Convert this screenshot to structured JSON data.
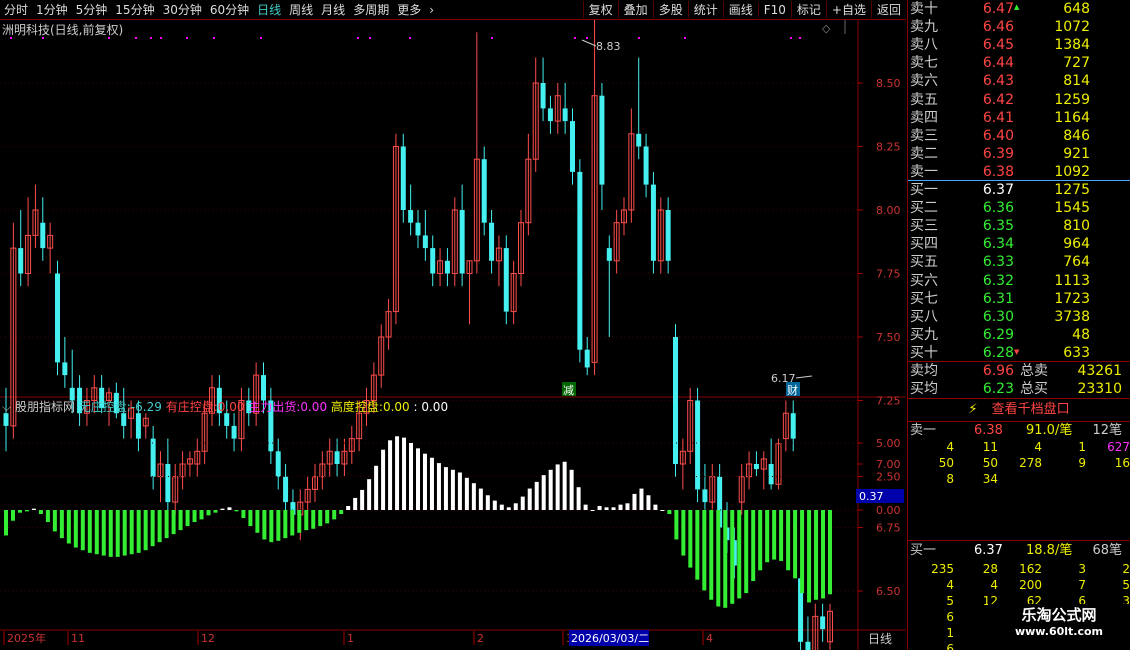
{
  "toolbar": {
    "periods": [
      "分时",
      "1分钟",
      "5分钟",
      "15分钟",
      "30分钟",
      "60分钟",
      "日线",
      "周线",
      "月线",
      "多周期",
      "更多"
    ],
    "active": "日线",
    "more_arrow": "›",
    "right": [
      "复权",
      "叠加",
      "多股",
      "统计",
      "画线",
      "F10",
      "标记",
      "+自选",
      "返回"
    ]
  },
  "main": {
    "title": "洲明科技(日线,前复权)",
    "hi_label": "8.83",
    "lo_label": "6.17",
    "marker_jian": "减",
    "marker_cai": "财",
    "axis": [
      "8.50",
      "8.25",
      "8.00",
      "7.75",
      "7.50",
      "7.25",
      "7.00",
      "6.75",
      "6.50"
    ]
  },
  "indicator": {
    "name": "股朋指标网",
    "wzkp_l": "无庄控盘:",
    "wzkp_v": "-6.29",
    "yzkp_l": "有庄控盘:",
    "yzkp_v": "0.00",
    "zlch_l": "主力出货:",
    "zlch_v": "0.00",
    "gdkp_l": "高度控盘:",
    "gdkp_v": "0.00",
    "extra": ": 0.00",
    "axis": [
      "5.00",
      "2.50",
      "0.00"
    ],
    "cursor_val": "0.37"
  },
  "dates": {
    "labels": [
      "2025年",
      "11",
      "12",
      "1",
      "2",
      "3"
    ],
    "highlight": "2026/03/03/二",
    "next": "4",
    "period": "日线"
  },
  "orderbook": {
    "asks": [
      {
        "n": "卖十",
        "p": "6.47",
        "v": "648"
      },
      {
        "n": "卖九",
        "p": "6.46",
        "v": "1072"
      },
      {
        "n": "卖八",
        "p": "6.45",
        "v": "1384"
      },
      {
        "n": "卖七",
        "p": "6.44",
        "v": "727"
      },
      {
        "n": "卖六",
        "p": "6.43",
        "v": "814"
      },
      {
        "n": "卖五",
        "p": "6.42",
        "v": "1259"
      },
      {
        "n": "卖四",
        "p": "6.41",
        "v": "1164"
      },
      {
        "n": "卖三",
        "p": "6.40",
        "v": "846"
      },
      {
        "n": "卖二",
        "p": "6.39",
        "v": "921"
      },
      {
        "n": "卖一",
        "p": "6.38",
        "v": "1092"
      }
    ],
    "bids": [
      {
        "n": "买一",
        "p": "6.37",
        "v": "1275"
      },
      {
        "n": "买二",
        "p": "6.36",
        "v": "1545"
      },
      {
        "n": "买三",
        "p": "6.35",
        "v": "810"
      },
      {
        "n": "买四",
        "p": "6.34",
        "v": "964"
      },
      {
        "n": "买五",
        "p": "6.33",
        "v": "764"
      },
      {
        "n": "买六",
        "p": "6.32",
        "v": "1113"
      },
      {
        "n": "买七",
        "p": "6.31",
        "v": "1723"
      },
      {
        "n": "买八",
        "p": "6.30",
        "v": "3738"
      },
      {
        "n": "买九",
        "p": "6.29",
        "v": "48"
      },
      {
        "n": "买十",
        "p": "6.28",
        "v": "633"
      }
    ],
    "avg_sell_l": "卖均",
    "avg_sell": "6.96",
    "total_sell_l": "总卖",
    "total_sell": "43261",
    "avg_buy_l": "买均",
    "avg_buy": "6.23",
    "total_buy_l": "总买",
    "total_buy": "23310",
    "link": "查看千档盘口",
    "sell1": {
      "n": "卖一",
      "p": "6.38",
      "per": "91.0/笔",
      "cnt": "12笔"
    },
    "sell_q": [
      [
        "4",
        "11",
        "4",
        "1",
        "627"
      ],
      [
        "50",
        "50",
        "278",
        "9",
        "16"
      ],
      [
        "8",
        "34",
        "",
        "",
        ""
      ]
    ],
    "buy1": {
      "n": "买一",
      "p": "6.37",
      "per": "18.8/笔",
      "cnt": "68笔"
    },
    "buy_q": [
      [
        "235",
        "28",
        "162",
        "3",
        "2"
      ],
      [
        "4",
        "4",
        "200",
        "7",
        "5"
      ],
      [
        "5",
        "12",
        "62",
        "6",
        "3"
      ],
      [
        "6",
        "",
        "",
        "",
        ""
      ],
      [
        "1",
        "",
        "",
        "",
        ""
      ],
      [
        "6",
        "",
        "",
        "",
        ""
      ]
    ]
  },
  "watermark": {
    "line1": "乐淘公式网",
    "line2": "www.60lt.com"
  },
  "chart_data": {
    "type": "candlestick",
    "title": "洲明科技(日线,前复权)",
    "y_ticks": [
      8.5,
      8.25,
      8.0,
      7.75,
      7.5,
      7.25,
      7.0,
      6.75,
      6.5
    ],
    "high_mark": 8.83,
    "low_mark": 6.17,
    "candles": [
      [
        7.2,
        7.3,
        7.05,
        7.15
      ],
      [
        7.15,
        7.95,
        7.1,
        7.85
      ],
      [
        7.85,
        8.0,
        7.7,
        7.75
      ],
      [
        7.75,
        8.05,
        7.7,
        7.9
      ],
      [
        7.9,
        8.1,
        7.85,
        8.0
      ],
      [
        7.95,
        8.05,
        7.8,
        7.85
      ],
      [
        7.85,
        7.95,
        7.75,
        7.9
      ],
      [
        7.75,
        7.8,
        7.35,
        7.4
      ],
      [
        7.4,
        7.5,
        7.3,
        7.35
      ],
      [
        7.3,
        7.45,
        7.2,
        7.25
      ],
      [
        7.3,
        7.35,
        7.15,
        7.2
      ],
      [
        7.2,
        7.3,
        7.15,
        7.25
      ],
      [
        7.25,
        7.35,
        7.2,
        7.3
      ],
      [
        7.3,
        7.35,
        7.2,
        7.22
      ],
      [
        7.25,
        7.3,
        7.15,
        7.28
      ],
      [
        7.28,
        7.32,
        7.18,
        7.2
      ],
      [
        7.2,
        7.3,
        7.1,
        7.15
      ],
      [
        7.18,
        7.25,
        7.1,
        7.22
      ],
      [
        7.2,
        7.25,
        7.05,
        7.1
      ],
      [
        7.15,
        7.2,
        7.1,
        7.18
      ],
      [
        7.1,
        7.15,
        6.9,
        6.95
      ],
      [
        6.95,
        7.05,
        6.85,
        7.0
      ],
      [
        7.0,
        7.1,
        6.75,
        6.85
      ],
      [
        6.85,
        7.0,
        6.8,
        6.95
      ],
      [
        6.95,
        7.05,
        6.9,
        7.0
      ],
      [
        7.0,
        7.05,
        6.95,
        7.02
      ],
      [
        7.0,
        7.1,
        6.95,
        7.05
      ],
      [
        7.05,
        7.25,
        7.0,
        7.2
      ],
      [
        7.2,
        7.35,
        7.15,
        7.3
      ],
      [
        7.3,
        7.35,
        7.15,
        7.2
      ],
      [
        7.2,
        7.25,
        7.1,
        7.15
      ],
      [
        7.15,
        7.2,
        7.05,
        7.1
      ],
      [
        7.1,
        7.3,
        7.05,
        7.25
      ],
      [
        7.25,
        7.3,
        7.15,
        7.2
      ],
      [
        7.2,
        7.4,
        7.15,
        7.35
      ],
      [
        7.35,
        7.4,
        7.2,
        7.25
      ],
      [
        7.25,
        7.3,
        7.0,
        7.05
      ],
      [
        7.05,
        7.1,
        6.9,
        6.95
      ],
      [
        6.95,
        7.0,
        6.8,
        6.85
      ],
      [
        6.85,
        6.9,
        6.75,
        6.8
      ],
      [
        6.8,
        6.9,
        6.7,
        6.85
      ],
      [
        6.85,
        6.95,
        6.8,
        6.9
      ],
      [
        6.9,
        7.0,
        6.85,
        6.95
      ],
      [
        6.95,
        7.05,
        6.9,
        7.0
      ],
      [
        7.0,
        7.1,
        6.95,
        7.05
      ],
      [
        7.05,
        7.1,
        6.95,
        7.0
      ],
      [
        7.0,
        7.1,
        6.95,
        7.05
      ],
      [
        7.05,
        7.15,
        7.0,
        7.1
      ],
      [
        7.1,
        7.25,
        7.05,
        7.2
      ],
      [
        7.2,
        7.3,
        7.15,
        7.25
      ],
      [
        7.25,
        7.4,
        7.2,
        7.35
      ],
      [
        7.35,
        7.55,
        7.3,
        7.5
      ],
      [
        7.5,
        7.65,
        7.45,
        7.6
      ],
      [
        7.6,
        8.3,
        7.55,
        8.25
      ],
      [
        8.25,
        8.3,
        7.95,
        8.0
      ],
      [
        8.0,
        8.1,
        7.9,
        7.95
      ],
      [
        7.95,
        8.0,
        7.85,
        7.9
      ],
      [
        7.9,
        8.0,
        7.8,
        7.85
      ],
      [
        7.85,
        7.9,
        7.7,
        7.75
      ],
      [
        7.75,
        7.85,
        7.7,
        7.8
      ],
      [
        7.8,
        7.85,
        7.7,
        7.75
      ],
      [
        7.75,
        8.05,
        7.7,
        8.0
      ],
      [
        8.0,
        8.1,
        7.7,
        7.75
      ],
      [
        7.75,
        7.8,
        7.55,
        7.8
      ],
      [
        7.8,
        8.7,
        7.75,
        8.2
      ],
      [
        8.2,
        8.25,
        7.9,
        7.95
      ],
      [
        7.95,
        8.0,
        7.75,
        7.8
      ],
      [
        7.8,
        7.9,
        7.7,
        7.85
      ],
      [
        7.85,
        7.9,
        7.55,
        7.6
      ],
      [
        7.6,
        7.8,
        7.55,
        7.75
      ],
      [
        7.75,
        8.0,
        7.7,
        7.95
      ],
      [
        7.95,
        8.3,
        7.9,
        8.2
      ],
      [
        8.2,
        8.6,
        8.15,
        8.5
      ],
      [
        8.5,
        8.6,
        8.35,
        8.4
      ],
      [
        8.4,
        8.45,
        8.3,
        8.35
      ],
      [
        8.35,
        8.5,
        8.3,
        8.45
      ],
      [
        8.4,
        8.5,
        8.3,
        8.35
      ],
      [
        8.35,
        8.4,
        8.1,
        8.15
      ],
      [
        8.15,
        8.2,
        7.4,
        7.45
      ],
      [
        7.45,
        7.5,
        7.35,
        7.38
      ],
      [
        7.4,
        8.83,
        7.35,
        8.45
      ],
      [
        8.45,
        8.5,
        8.0,
        8.1
      ],
      [
        7.85,
        7.9,
        7.5,
        7.8
      ],
      [
        7.8,
        8.0,
        7.75,
        7.95
      ],
      [
        7.95,
        8.05,
        7.9,
        8.0
      ],
      [
        8.0,
        8.4,
        7.95,
        8.3
      ],
      [
        8.3,
        8.6,
        8.2,
        8.25
      ],
      [
        8.25,
        8.3,
        8.05,
        8.1
      ],
      [
        8.1,
        8.15,
        7.75,
        7.8
      ],
      [
        7.8,
        8.05,
        7.75,
        8.0
      ],
      [
        8.0,
        8.05,
        7.75,
        7.8
      ],
      [
        7.5,
        7.55,
        6.95,
        7.0
      ],
      [
        7.0,
        7.1,
        6.9,
        7.05
      ],
      [
        7.05,
        7.3,
        7.0,
        7.25
      ],
      [
        7.25,
        7.3,
        6.85,
        6.9
      ],
      [
        6.9,
        7.0,
        6.8,
        6.85
      ],
      [
        6.85,
        7.0,
        6.8,
        6.95
      ],
      [
        6.95,
        7.0,
        6.7,
        6.75
      ],
      [
        6.75,
        6.85,
        6.65,
        6.7
      ],
      [
        6.7,
        6.75,
        6.55,
        6.6
      ],
      [
        6.85,
        7.0,
        6.8,
        6.95
      ],
      [
        6.95,
        7.05,
        6.9,
        7.0
      ],
      [
        7.0,
        7.05,
        6.95,
        6.98
      ],
      [
        6.98,
        7.05,
        6.9,
        7.02
      ],
      [
        7.0,
        7.1,
        6.9,
        6.92
      ],
      [
        6.92,
        7.1,
        6.9,
        7.08
      ],
      [
        7.1,
        7.25,
        7.05,
        7.2
      ],
      [
        7.2,
        7.25,
        7.05,
        7.1
      ],
      [
        6.55,
        6.55,
        6.25,
        6.3
      ],
      [
        6.3,
        6.4,
        6.2,
        6.25
      ],
      [
        6.25,
        6.45,
        6.17,
        6.4
      ],
      [
        6.4,
        6.45,
        6.3,
        6.35
      ],
      [
        6.3,
        6.45,
        6.25,
        6.42
      ]
    ],
    "ind_values": [
      -1.9,
      -0.8,
      -0.2,
      -0.1,
      0.1,
      -0.3,
      -0.9,
      -1.6,
      -2.1,
      -2.5,
      -2.8,
      -3.0,
      -3.2,
      -3.3,
      -3.4,
      -3.5,
      -3.5,
      -3.4,
      -3.3,
      -3.2,
      -3.0,
      -2.7,
      -2.4,
      -2.1,
      -1.8,
      -1.5,
      -1.2,
      -0.9,
      -0.7,
      -0.4,
      -0.2,
      0.1,
      0.2,
      -0.1,
      -0.6,
      -1.2,
      -1.7,
      -2.2,
      -2.4,
      -2.3,
      -2.1,
      -1.9,
      -1.7,
      -1.5,
      -1.4,
      -1.2,
      -1.0,
      -0.7,
      -0.3,
      0.3,
      0.9,
      1.5,
      2.3,
      3.3,
      4.5,
      5.2,
      5.5,
      5.4,
      5.0,
      4.6,
      4.2,
      3.9,
      3.5,
      3.2,
      3.0,
      2.8,
      2.4,
      2.0,
      1.6,
      1.1,
      0.7,
      0.4,
      0.2,
      0.5,
      1.0,
      1.6,
      2.1,
      2.6,
      3.0,
      3.4,
      3.6,
      3.0,
      1.7,
      0.4,
      0.0,
      0.3,
      0.2,
      0.2,
      0.4,
      0.5,
      1.2,
      1.6,
      1.1,
      0.4,
      0.0,
      -0.3,
      -2.2,
      -3.4,
      -4.3,
      -5.2,
      -6.0,
      -6.7,
      -7.2,
      -7.3,
      -7.0,
      -6.6,
      -6.2,
      -5.3,
      -4.5,
      -3.9,
      -3.7,
      -3.8,
      -4.5,
      -5.1,
      -6.2,
      -6.9,
      -6.7,
      -6.6,
      -6.29
    ]
  }
}
